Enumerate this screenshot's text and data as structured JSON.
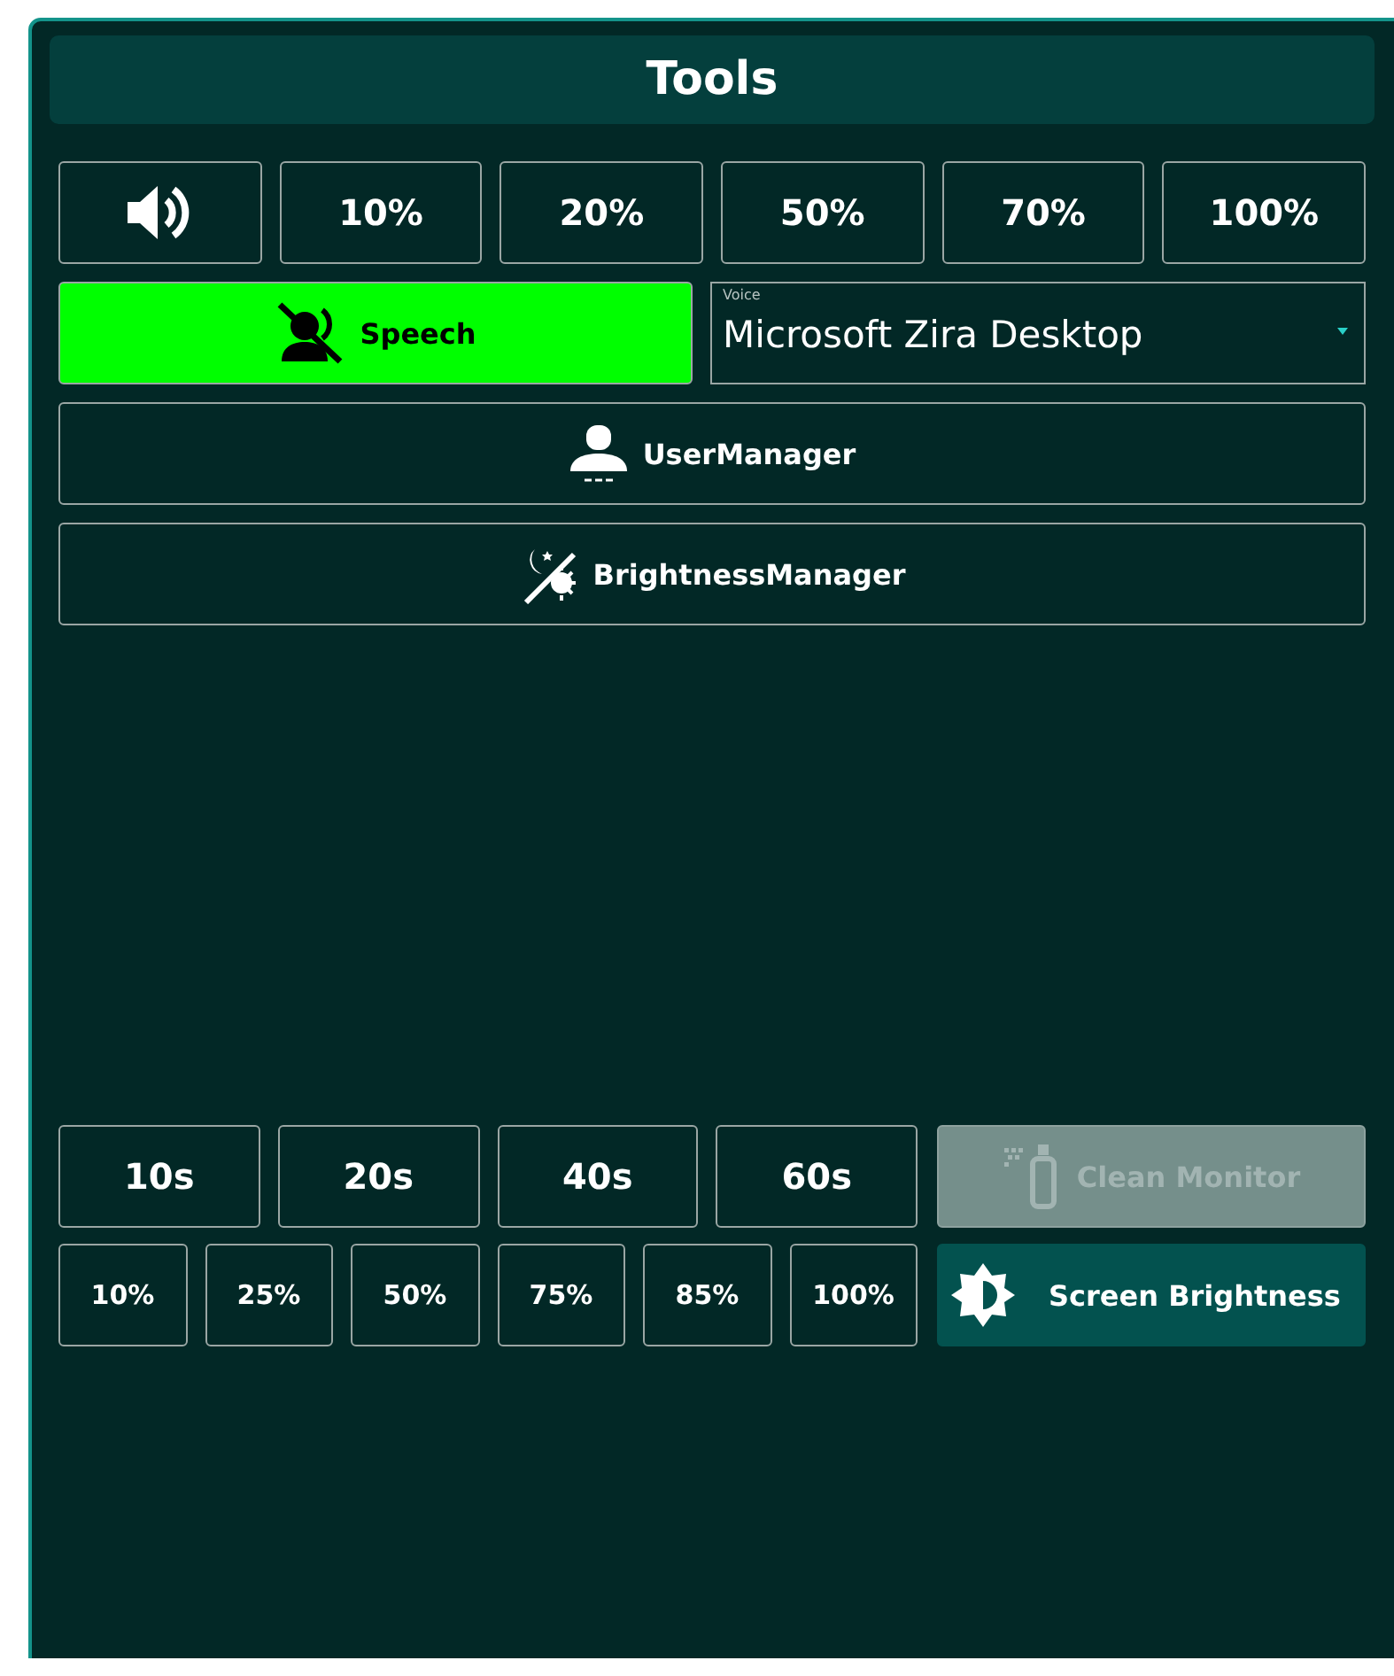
{
  "title": "Tools",
  "volume_buttons": [
    {
      "kind": "icon"
    },
    {
      "kind": "text",
      "label": "10%"
    },
    {
      "kind": "text",
      "label": "20%"
    },
    {
      "kind": "text",
      "label": "50%"
    },
    {
      "kind": "text",
      "label": "70%"
    },
    {
      "kind": "text",
      "label": "100%"
    }
  ],
  "speech": {
    "label": "Speech",
    "on": true
  },
  "voice": {
    "label": "Voice",
    "value": "Microsoft Zira Desktop"
  },
  "managers": [
    {
      "kind": "user",
      "label": "UserManager"
    },
    {
      "kind": "brightness",
      "label": "BrightnessManager"
    }
  ],
  "timer_buttons": [
    "10s",
    "20s",
    "40s",
    "60s"
  ],
  "clean_monitor": {
    "label": "Clean Monitor",
    "disabled": true
  },
  "brightness_buttons": [
    "10%",
    "25%",
    "50%",
    "75%",
    "85%",
    "100%"
  ],
  "screen_brightness": {
    "label": "Screen Brightness"
  }
}
